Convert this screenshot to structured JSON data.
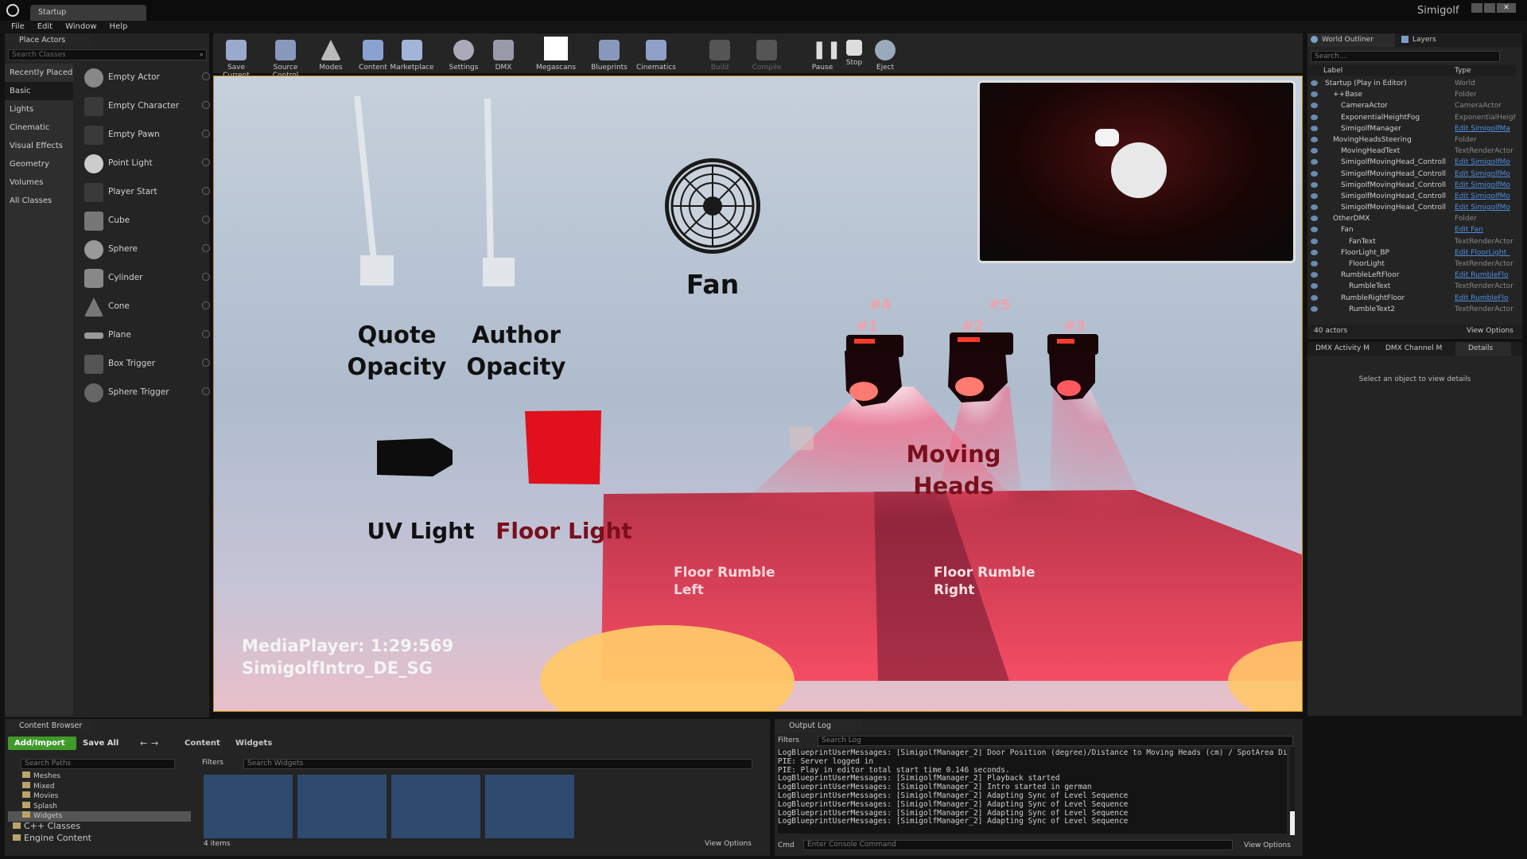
{
  "window": {
    "tab_title": "Startup",
    "app_name": "Simigolf"
  },
  "menu": [
    "File",
    "Edit",
    "Window",
    "Help"
  ],
  "place_actors": {
    "tab": "Place Actors",
    "search_placeholder": "Search Classes",
    "categories": [
      "Recently Placed",
      "Basic",
      "Lights",
      "Cinematic",
      "Visual Effects",
      "Geometry",
      "Volumes",
      "All Classes"
    ],
    "items": [
      "Empty Actor",
      "Empty Character",
      "Empty Pawn",
      "Point Light",
      "Player Start",
      "Cube",
      "Sphere",
      "Cylinder",
      "Cone",
      "Plane",
      "Box Trigger",
      "Sphere Trigger"
    ]
  },
  "toolbar": {
    "save_current": "Save Current",
    "source_control": "Source Control",
    "modes": "Modes",
    "content": "Content",
    "marketplace": "Marketplace",
    "settings": "Settings",
    "dmx": "DMX",
    "megascans": "Megascans",
    "blueprints": "Blueprints",
    "cinematics": "Cinematics",
    "build": "Build",
    "compile": "Compile",
    "pause": "Pause",
    "stop": "Stop",
    "eject": "Eject"
  },
  "viewport": {
    "quote_opacity": "Quote\nOpacity",
    "author_opacity": "Author\nOpacity",
    "fan": "Fan",
    "uv_light": "UV Light",
    "floor_light": "Floor Light",
    "moving_heads": "Moving\nHeads",
    "floor_rumble_left": "Floor Rumble\nLeft",
    "floor_rumble_right": "Floor Rumble\nRight",
    "head_labels": [
      "#4",
      "#5",
      "#1",
      "#2",
      "#3"
    ],
    "media_player": "MediaPlayer: 1:29:569",
    "media_name": "SimigolfIntro_DE_SG"
  },
  "outliner": {
    "tab": "World Outliner",
    "layers_tab": "Layers",
    "search_placeholder": "Search...",
    "col_label": "Label",
    "col_type": "Type",
    "rows": [
      {
        "name": "Startup (Play in Editor)",
        "type": "World",
        "link": false,
        "indent": 0
      },
      {
        "name": "++Base",
        "type": "Folder",
        "link": false,
        "indent": 1
      },
      {
        "name": "CameraActor",
        "type": "CameraActor",
        "link": false,
        "indent": 2
      },
      {
        "name": "ExponentialHeightFog",
        "type": "ExponentialHeigh",
        "link": false,
        "indent": 2
      },
      {
        "name": "SimigolfManager",
        "type": "Edit SimigolfMa",
        "link": true,
        "indent": 2
      },
      {
        "name": "MovingHeadsSteering",
        "type": "Folder",
        "link": false,
        "indent": 1
      },
      {
        "name": "MovingHeadText",
        "type": "TextRenderActor",
        "link": false,
        "indent": 2
      },
      {
        "name": "SimigolfMovingHead_Controll",
        "type": "Edit SimigolfMo",
        "link": true,
        "indent": 2
      },
      {
        "name": "SimigolfMovingHead_Controll",
        "type": "Edit SimigolfMo",
        "link": true,
        "indent": 2
      },
      {
        "name": "SimigolfMovingHead_Controll",
        "type": "Edit SimigolfMo",
        "link": true,
        "indent": 2
      },
      {
        "name": "SimigolfMovingHead_Controll",
        "type": "Edit SimigolfMo",
        "link": true,
        "indent": 2
      },
      {
        "name": "SimigolfMovingHead_Controll",
        "type": "Edit SimigolfMo",
        "link": true,
        "indent": 2
      },
      {
        "name": "OtherDMX",
        "type": "Folder",
        "link": false,
        "indent": 1
      },
      {
        "name": "Fan",
        "type": "Edit Fan",
        "link": true,
        "indent": 2
      },
      {
        "name": "FanText",
        "type": "TextRenderActor",
        "link": false,
        "indent": 3
      },
      {
        "name": "FloorLight_BP",
        "type": "Edit FloorLight_",
        "link": true,
        "indent": 2
      },
      {
        "name": "FloorLight",
        "type": "TextRenderActor",
        "link": false,
        "indent": 3
      },
      {
        "name": "RumbleLeftFloor",
        "type": "Edit RumbleFlo",
        "link": true,
        "indent": 2
      },
      {
        "name": "RumbleText",
        "type": "TextRenderActor",
        "link": false,
        "indent": 3
      },
      {
        "name": "RumbleRightFloor",
        "type": "Edit RumbleFlo",
        "link": true,
        "indent": 2
      },
      {
        "name": "RumbleText2",
        "type": "TextRenderActor",
        "link": false,
        "indent": 3
      }
    ],
    "count": "40 actors",
    "view_options": "View Options"
  },
  "details": {
    "tabs": [
      "DMX Activity M",
      "DMX Channel M",
      "Details"
    ],
    "empty": "Select an object to view details"
  },
  "content_browser": {
    "tab": "Content Browser",
    "add_import": "Add/Import",
    "save_all": "Save All",
    "breadcrumb": [
      "Content",
      "Widgets"
    ],
    "search_paths": "Search Paths",
    "filters": "Filters",
    "search_widgets": "Search Widgets",
    "tree": [
      {
        "label": "Meshes",
        "indent": 1
      },
      {
        "label": "Mixed",
        "indent": 1
      },
      {
        "label": "Movies",
        "indent": 1
      },
      {
        "label": "Splash",
        "indent": 1
      },
      {
        "label": "Widgets",
        "indent": 1
      },
      {
        "label": "C++ Classes",
        "indent": 0
      },
      {
        "label": "Engine Content",
        "indent": 0
      }
    ],
    "items_count": "4 items",
    "view_options": "View Options"
  },
  "output_log": {
    "tab": "Output Log",
    "filters": "Filters",
    "search": "Search Log",
    "lines": [
      "LogBlueprintUserMessages: [SimigolfManager_2] Door Position (degree)/Distance to Moving Heads (cm) / SpotArea Diameter",
      "PIE: Server logged in",
      "PIE: Play in editor total start time 0.146 seconds.",
      "LogBlueprintUserMessages: [SimigolfManager_2] Playback started",
      "LogBlueprintUserMessages: [SimigolfManager_2] Intro started in  german",
      "LogBlueprintUserMessages: [SimigolfManager_2] Adapting Sync of Level Sequence",
      "LogBlueprintUserMessages: [SimigolfManager_2] Adapting Sync of Level Sequence",
      "LogBlueprintUserMessages: [SimigolfManager_2] Adapting Sync of Level Sequence",
      "LogBlueprintUserMessages: [SimigolfManager_2] Adapting Sync of Level Sequence"
    ],
    "cmd": "Cmd",
    "console_placeholder": "Enter Console Command",
    "view_options": "View Options"
  }
}
